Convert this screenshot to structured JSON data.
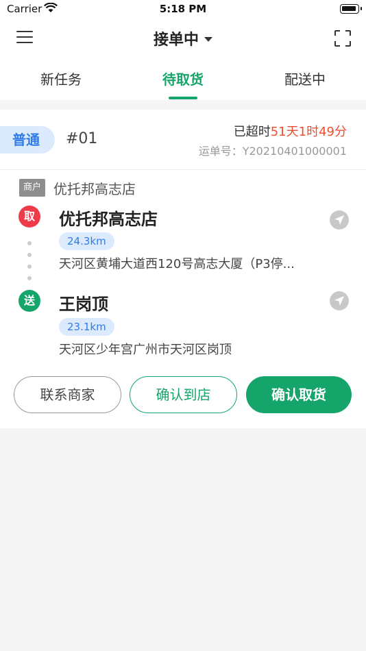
{
  "status_bar": {
    "carrier": "Carrier",
    "time": "5:18 PM"
  },
  "nav": {
    "title": "接单中",
    "menu_icon": "hamburger-menu-icon",
    "scan_icon": "scan-icon"
  },
  "tabs": [
    {
      "label": "新任务",
      "active": false
    },
    {
      "label": "待取货",
      "active": true
    },
    {
      "label": "配送中",
      "active": false
    }
  ],
  "accent_color": "#15a56a",
  "order": {
    "type_badge": "普通",
    "number": "#01",
    "overdue_prefix": "已超时",
    "overdue_time": "51天1时49分",
    "waybill_label": "运单号：",
    "waybill_no": "Y20210401000001",
    "merchant_tag": "商户",
    "merchant_name": "优托邦高志店",
    "pickup": {
      "marker": "取",
      "name": "优托邦高志店",
      "distance": "24.3km",
      "address": "天河区黄埔大道西120号高志大厦（P3停..."
    },
    "delivery": {
      "marker": "送",
      "name": "王岗顶",
      "distance": "23.1km",
      "address": "天河区少年宫广州市天河区岗顶"
    }
  },
  "actions": {
    "contact_merchant": "联系商家",
    "confirm_arrival": "确认到店",
    "confirm_pickup": "确认取货"
  }
}
